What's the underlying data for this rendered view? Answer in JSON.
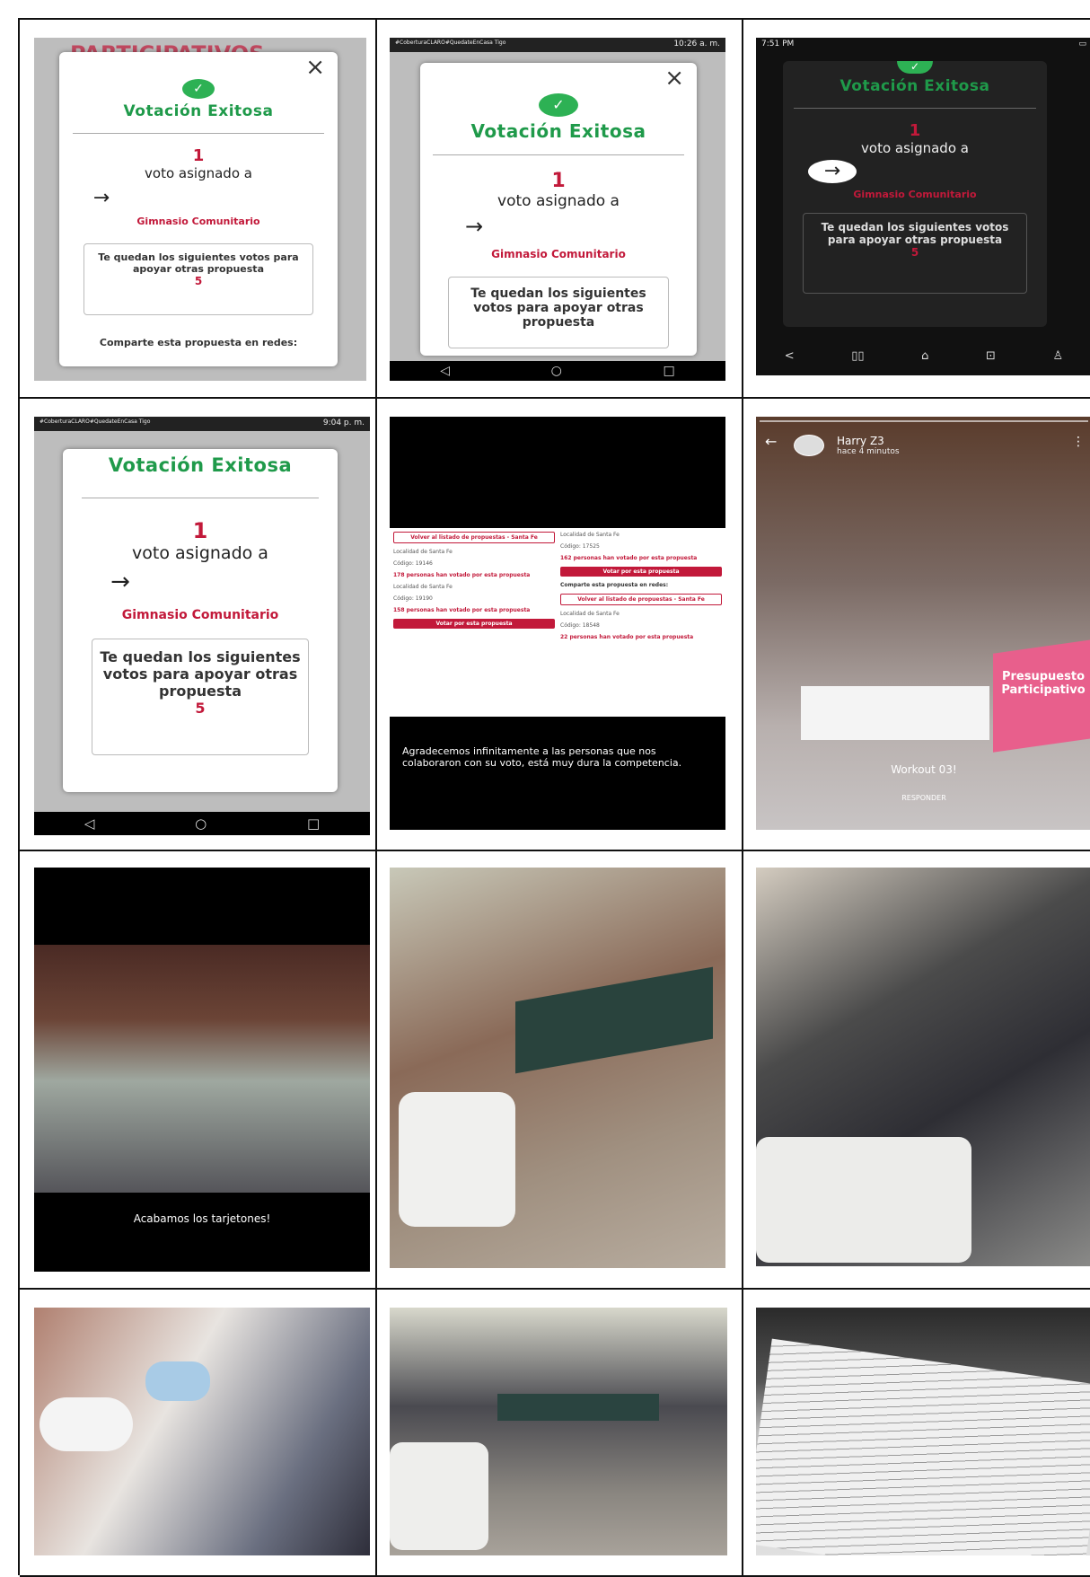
{
  "cell1": {
    "title": "Votación Exitosa",
    "count": "1",
    "assigned": "voto asignado a",
    "project": "Gimnasio Comunitario",
    "remaining_text": "Te quedan los siguientes votos para apoyar otras propuesta",
    "remaining": "5",
    "share": "Comparte esta propuesta en redes:",
    "background_title": "PARTICIPATIVOS"
  },
  "cell2": {
    "status": "#CoberturaCLARO#QuedateEnCasa Tigo",
    "time": "10:26 a. m.",
    "title": "Votación Exitosa",
    "count": "1",
    "assigned": "voto asignado a",
    "project": "Gimnasio Comunitario",
    "remaining_text": "Te quedan los siguientes votos para apoyar otras propuesta"
  },
  "cell3": {
    "time": "7:51 PM",
    "title": "Votación Exitosa",
    "count": "1",
    "assigned": "voto asignado a",
    "project": "Gimnasio Comunitario",
    "remaining_text": "Te quedan los siguientes votos para apoyar otras propuesta",
    "remaining": "5"
  },
  "cell4": {
    "status": "#CoberturaCLARO#QuedateEnCasa Tigo",
    "time": "9:04 p. m.",
    "title": "Votación Exitosa",
    "count": "1",
    "assigned": "voto asignado a",
    "project": "Gimnasio Comunitario",
    "remaining_text": "Te quedan los siguientes votos para apoyar otras propuesta",
    "remaining": "5"
  },
  "cell5": {
    "back_label": "Volver al listado de propuestas - Santa Fe",
    "locality1": "Localidad de Santa Fe",
    "code1": "Código: 19146",
    "votes1": "178 personas han votado por esta propuesta",
    "locality2": "Localidad de Santa Fe",
    "code2": "Código: 19190",
    "votes2": "158 personas han votado por esta propuesta",
    "vote_btn": "Votar por esta propuesta",
    "locality3": "Localidad de Santa Fe",
    "code3": "Código: 17525",
    "votes3": "162 personas han votado por esta propuesta",
    "vote_btn2": "Votar por esta propuesta",
    "share": "Comparte esta propuesta en redes:",
    "back_label2": "Volver al listado de propuestas - Santa Fe",
    "locality4": "Localidad de Santa Fe",
    "code4": "Código: 18548",
    "votes4": "22 personas han votado por esta propuesta",
    "message": "Agradecemos infinitamente a las personas que nos colaboraron con su voto, está muy dura la competencia."
  },
  "cell6": {
    "user": "Harry Z3",
    "when": "hace 4 minutos",
    "caption": "Workout 03!",
    "reply": "RESPONDER",
    "box_label": "Presupuesto Participativo"
  },
  "cell7": {
    "caption": "Acabamos los tarjetones!"
  },
  "colors": {
    "green": "#2db154",
    "red": "#c2193a",
    "dark_bg": "#222222"
  }
}
